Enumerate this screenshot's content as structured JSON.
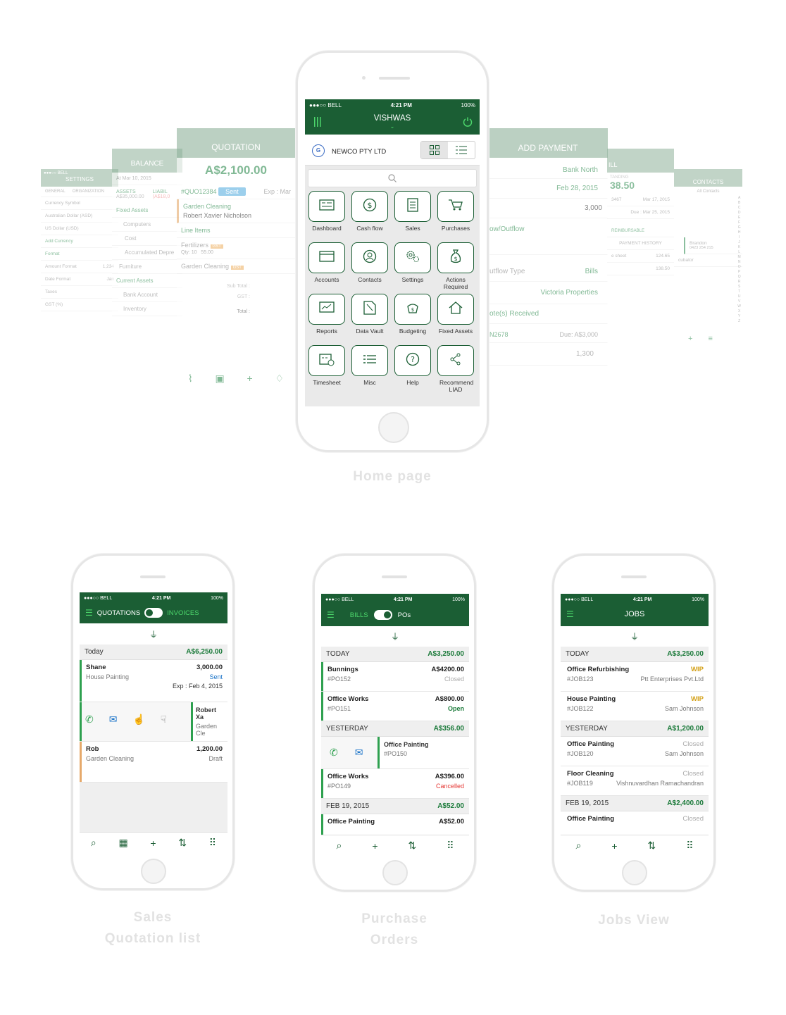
{
  "status": {
    "carrier": "●●●○○ BELL",
    "time": "4:21 PM",
    "battery": "100%"
  },
  "home": {
    "header_title": "VISHWAS",
    "company": "NEWCO PTY LTD",
    "search_placeholder": "",
    "tiles": [
      {
        "label": "Dashboard",
        "icon": "dashboard-icon"
      },
      {
        "label": "Cash flow",
        "icon": "cash-flow-icon"
      },
      {
        "label": "Sales",
        "icon": "sales-icon"
      },
      {
        "label": "Purchases",
        "icon": "cart-icon"
      },
      {
        "label": "Accounts",
        "icon": "accounts-icon"
      },
      {
        "label": "Contacts",
        "icon": "contacts-icon"
      },
      {
        "label": "Settings",
        "icon": "settings-icon"
      },
      {
        "label": "Actions Required",
        "icon": "money-bag-icon"
      },
      {
        "label": "Reports",
        "icon": "reports-icon"
      },
      {
        "label": "Data Vault",
        "icon": "data-vault-icon"
      },
      {
        "label": "Budgeting",
        "icon": "budgeting-icon"
      },
      {
        "label": "Fixed Assets",
        "icon": "home-icon"
      },
      {
        "label": "Timesheet",
        "icon": "timesheet-icon"
      },
      {
        "label": "Misc",
        "icon": "list-icon"
      },
      {
        "label": "Help",
        "icon": "help-icon"
      },
      {
        "label": "Recommend LIAD",
        "icon": "share-icon"
      }
    ]
  },
  "bg_screens": {
    "settings": {
      "title": "SETTINGS",
      "tabs": [
        "GENERAL",
        "ORGANIZATION"
      ],
      "rows": [
        "Currency Symbol",
        "Australian Dollar (ASD)",
        "US Dollar (USD)",
        "Add Currency",
        "Format",
        "Amount Format",
        "Date Format",
        "Taxes",
        "GST (%)"
      ],
      "amount_value": "1,234",
      "date_value": "Jan"
    },
    "balance": {
      "title": "BALANCE",
      "date": "At Mar 10, 2015",
      "assets_label": "ASSETS",
      "assets_value": "A$35,000.00",
      "liab_label": "LIABIL",
      "liab_value": "(A$18,0",
      "rows": [
        "Fixed Assets",
        "Computers",
        "Cost",
        "Accumulated Depre",
        "Furniture",
        "Current Assets",
        "Bank Account",
        "Inventory"
      ]
    },
    "quotation": {
      "title": "QUOTATION",
      "amount": "A$2,100.00",
      "number": "#QUO12384",
      "badge": "Sent",
      "exp": "Exp : Mar",
      "service": "Garden Cleaning",
      "client": "Robert Xavier Nicholson",
      "line_items": "Line Items",
      "item1": "Fertilizers",
      "gst": "GST",
      "qty": "Qty: 10",
      "price": "55.00",
      "item2": "Garden Cleaning",
      "subtotal": "Sub Total :",
      "gst_total": "GST :",
      "total": "Total :"
    },
    "payment": {
      "title": "ADD PAYMENT",
      "bank": "Bank North",
      "date": "Feb 28, 2015",
      "amount": "3,000",
      "flow": "ow/Outflow",
      "type_label": "utflow Type",
      "type_value": "Bills",
      "property": "Victoria Properties",
      "notes": "ote(s) Received",
      "ref": "N2678",
      "due": "Due: A$3,000",
      "paid": "1,300"
    },
    "bill": {
      "title": "ILL",
      "label": "TANDING",
      "amount": "38.50",
      "ref": "3467",
      "date1": "Mar 17, 2015",
      "due": "Due : Mar 25, 2015",
      "reimb": "REIMBURSABLE",
      "history": "PAYMENT HISTORY",
      "sheet": "e sheet",
      "v1": "124.65",
      "v2": "138.50"
    },
    "contacts": {
      "title": "CONTACTS",
      "filter": "All Contacts",
      "name": "Brandon",
      "phone": "0423 254 215",
      "other": "cubator",
      "letters": [
        "A",
        "B",
        "C",
        "D",
        "E",
        "F",
        "G",
        "H",
        "I",
        "J",
        "K",
        "L",
        "M",
        "N",
        "O",
        "P",
        "Q",
        "R",
        "S",
        "T",
        "U",
        "V",
        "W",
        "X",
        "Y",
        "Z"
      ]
    }
  },
  "captions": {
    "home": "Home page",
    "sales": "Sales\nQuotation list",
    "purchase": "Purchase\nOrders",
    "jobs": "Jobs View"
  },
  "sales": {
    "toggle_left": "QUOTATIONS",
    "toggle_right": "INVOICES",
    "sections": [
      {
        "label": "Today",
        "amount": "A$6,250.00"
      }
    ],
    "rows": [
      {
        "name": "Shane",
        "amount": "3,000.00",
        "desc": "House Painting",
        "status": "Sent",
        "exp": "Exp : Feb 4, 2015"
      },
      {
        "name": "Robert Xa",
        "desc": "Garden Cle"
      },
      {
        "name": "Rob",
        "amount": "1,200.00",
        "desc": "Garden Cleaning",
        "status": "Draft"
      }
    ]
  },
  "purchase": {
    "toggle_left": "BILLS",
    "toggle_right": "POs",
    "sections": [
      {
        "label": "TODAY",
        "amount": "A$3,250.00"
      },
      {
        "label": "YESTERDAY",
        "amount": "A$356.00"
      },
      {
        "label": "FEB 19, 2015",
        "amount": "A$52.00"
      }
    ],
    "rows": [
      {
        "name": "Bunnings",
        "amount": "A$4200.00",
        "ref": "#PO152",
        "status": "Closed"
      },
      {
        "name": "Office Works",
        "amount": "A$800.00",
        "ref": "#PO151",
        "status": "Open"
      },
      {
        "name": "Office Painting",
        "ref": "#PO150"
      },
      {
        "name": "Office Works",
        "amount": "A$396.00",
        "ref": "#PO149",
        "status": "Cancelled"
      },
      {
        "name": "Office Painting",
        "amount": "A$52.00"
      }
    ]
  },
  "jobs": {
    "title": "JOBS",
    "sections": [
      {
        "label": "TODAY",
        "amount": "A$3,250.00"
      },
      {
        "label": "YESTERDAY",
        "amount": "A$1,200.00"
      },
      {
        "label": "FEB 19, 2015",
        "amount": "A$2,400.00"
      }
    ],
    "rows": [
      {
        "name": "Office Refurbishing",
        "status": "WIP",
        "ref": "#JOB123",
        "client": "Ptt Enterprises Pvt.Ltd"
      },
      {
        "name": "House Painting",
        "status": "WIP",
        "ref": "#JOB122",
        "client": "Sam Johnson"
      },
      {
        "name": "Office Painting",
        "status": "Closed",
        "ref": "#JOB120",
        "client": "Sam Johnson"
      },
      {
        "name": "Floor Cleaning",
        "status": "Closed",
        "ref": "#JOB119",
        "client": "Vishnuvardhan Ramachandran"
      },
      {
        "name": "Office Painting",
        "status": "Closed"
      }
    ]
  },
  "colors": {
    "brand_green": "#1b5e34",
    "accent_green": "#1b7a3a",
    "wip": "#d4a017",
    "cancelled": "#e53935",
    "open": "#1b7a3a",
    "sent": "#1a73c8"
  }
}
